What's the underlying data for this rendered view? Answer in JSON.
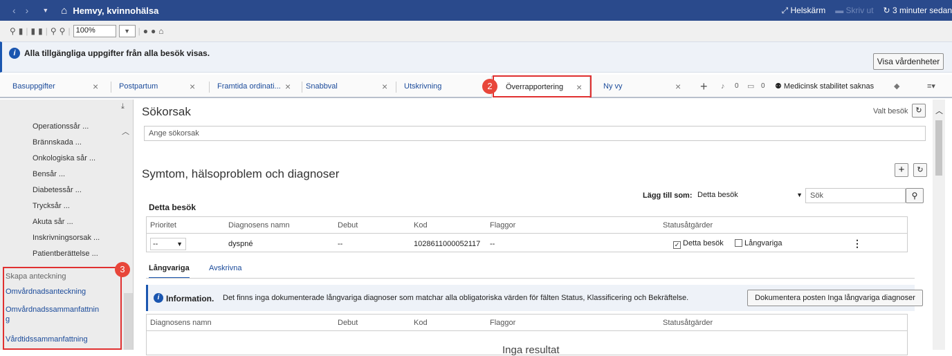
{
  "titlebar": {
    "title": "Hemvy, kvinnohälsa",
    "fullscreen": "Helskärm",
    "dim_action": "Skriv ut",
    "refresh": "3 minuter sedan"
  },
  "toolbar": {
    "zoom": "100%"
  },
  "info": {
    "text": "Alla tillgängliga uppgifter från alla besök visas.",
    "button": "Visa vårdenheter"
  },
  "tabs": [
    "Basuppgifter",
    "Postpartum",
    "Framtida ordinati...",
    "Snabbval",
    "Utskrivning",
    "Överrapportering",
    "Ny vy"
  ],
  "tabbar_right": {
    "count1": "0",
    "count2": "0",
    "warning": "Medicinsk stabilitet saknas"
  },
  "sidebar": {
    "items": [
      "Operationssår ...",
      "Brännskada ...",
      "Onkologiska sår ...",
      "Bensår ...",
      "Diabetessår ...",
      "Trycksår ...",
      "Akuta sår ...",
      "Inskrivningsorsak ...",
      "Patientberättelse ..."
    ],
    "section": "Skapa anteckning",
    "links": [
      "Omvårdnadsanteckning",
      "Omvårdnadssammanfattnin",
      "g",
      "Vårdtidssammanfattning"
    ]
  },
  "annotations": {
    "badge2": "2",
    "badge3": "3"
  },
  "sokorsak": {
    "title": "Sökorsak",
    "valt_besok": "Valt besök",
    "placeholder": "Ange sökorsak"
  },
  "symptom": {
    "title": "Symtom, hälsoproblem och diagnoser",
    "lagg_till_label": "Lägg till som:",
    "lagg_till_value": "Detta besök",
    "search_placeholder": "Sök",
    "section_label": "Detta besök",
    "columns": [
      "Prioritet",
      "Diagnosens namn",
      "Debut",
      "Kod",
      "Flaggor",
      "Statusåtgärder"
    ],
    "row": {
      "prio": "--",
      "name": "dyspné",
      "debut": "--",
      "kod": "1028611000052117",
      "flaggor": "--",
      "status1": "Detta besök",
      "status2": "Långvariga"
    }
  },
  "subtabs": [
    "Långvariga",
    "Avskrivna"
  ],
  "infobox": {
    "bold": "Information.",
    "text": "Det finns inga dokumenterade långvariga diagnoser som matchar alla obligatoriska värden för fälten Status, Klassificering och Bekräftelse.",
    "button": "Dokumentera posten Inga långvariga diagnoser"
  },
  "long_table": {
    "columns": [
      "Diagnosens namn",
      "Debut",
      "Kod",
      "Flaggor",
      "Statusåtgärder"
    ],
    "empty": "Inga resultat"
  }
}
